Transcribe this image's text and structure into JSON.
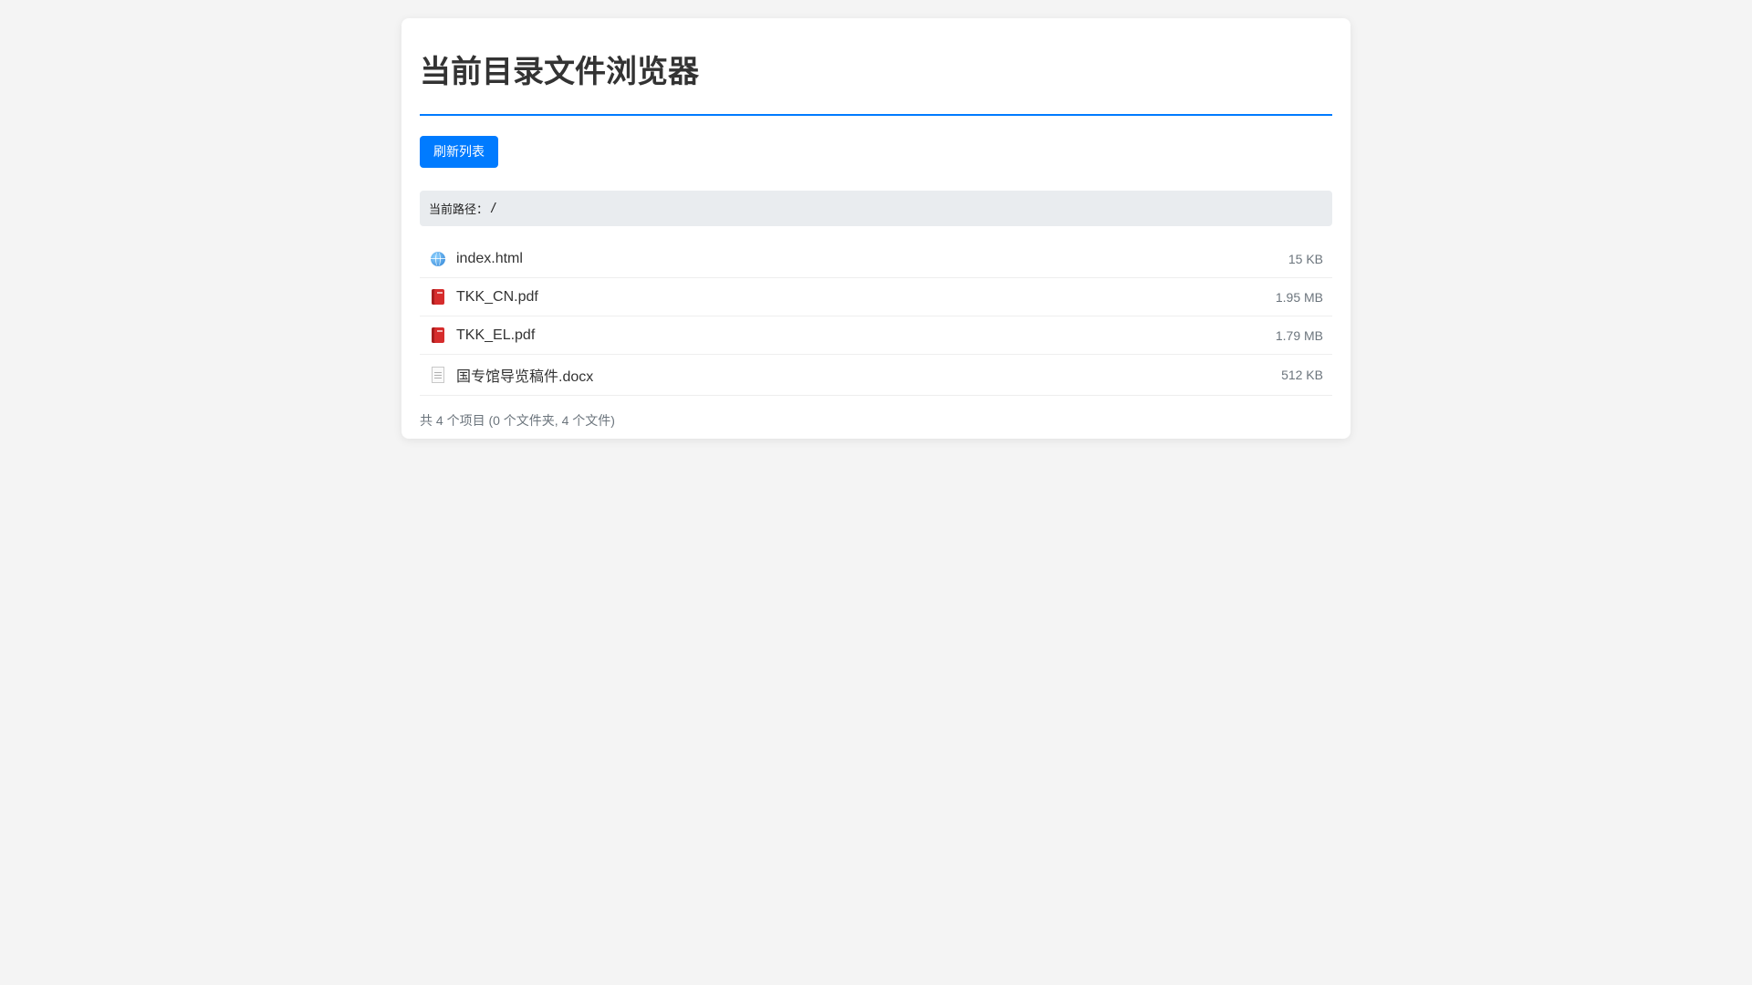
{
  "header": {
    "title": "当前目录文件浏览器"
  },
  "toolbar": {
    "refresh_label": "刷新列表"
  },
  "path": {
    "label": "当前路径：",
    "value": "/"
  },
  "files": [
    {
      "name": "index.html",
      "size": "15 KB",
      "icon": "globe-icon"
    },
    {
      "name": "TKK_CN.pdf",
      "size": "1.95 MB",
      "icon": "red-book-icon"
    },
    {
      "name": "TKK_EL.pdf",
      "size": "1.79 MB",
      "icon": "red-book-icon"
    },
    {
      "name": "国专馆导览稿件.docx",
      "size": "512 KB",
      "icon": "document-icon"
    }
  ],
  "summary": "共 4 个项目 (0 个文件夹, 4 个文件)",
  "colors": {
    "accent": "#007bff",
    "background": "#f4f4f4",
    "muted_text": "#6c757d",
    "path_bar": "#e9ecef"
  }
}
